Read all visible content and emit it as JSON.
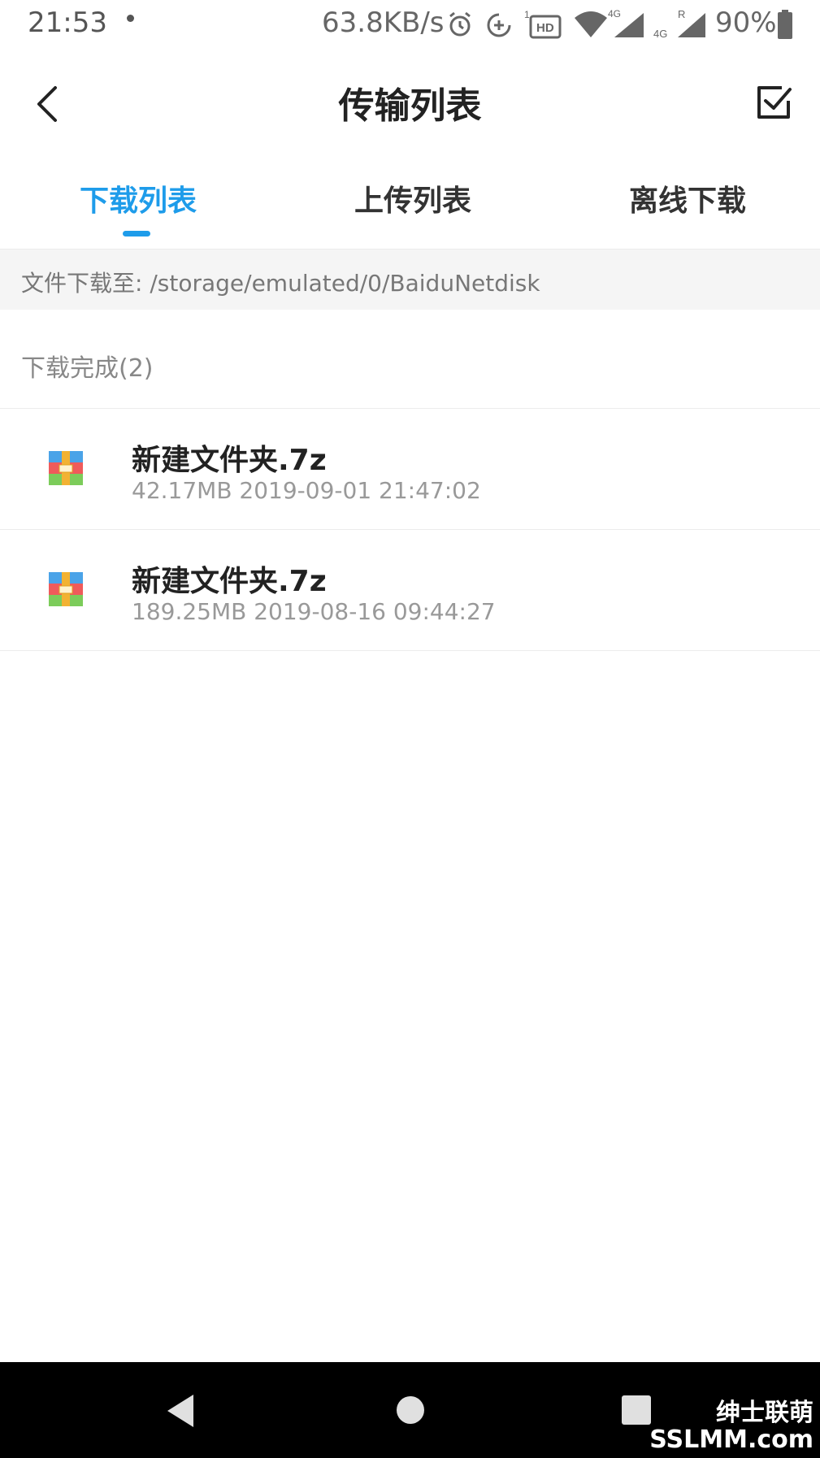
{
  "status_bar": {
    "time": "21:53",
    "net_speed": "63.8KB/s",
    "battery": "90%",
    "icons": [
      "dot-icon",
      "alarm-icon",
      "data-saver-icon",
      "hd-icon",
      "wifi-icon",
      "signal-4g-icon",
      "signal-r-icon",
      "battery-icon"
    ],
    "hd_label": "HD",
    "sim1_label": "4G",
    "sim2_label": "4G",
    "roaming_label": "R"
  },
  "header": {
    "title": "传输列表",
    "back_icon": "chevron-left-icon",
    "select_icon": "checkbox-icon"
  },
  "tabs": [
    {
      "label": "下载列表",
      "active": true
    },
    {
      "label": "上传列表",
      "active": false
    },
    {
      "label": "离线下载",
      "active": false
    }
  ],
  "path_bar": {
    "text": "文件下载至: /storage/emulated/0/BaiduNetdisk"
  },
  "section": {
    "title": "下载完成(2)"
  },
  "files": [
    {
      "name": "新建文件夹.7z",
      "meta": "42.17MB 2019-09-01 21:47:02",
      "icon": "archive-icon"
    },
    {
      "name": "新建文件夹.7z",
      "meta": "189.25MB 2019-08-16 09:44:27",
      "icon": "archive-icon"
    }
  ],
  "nav_bar": {
    "buttons": [
      "back-triangle-icon",
      "home-circle-icon",
      "recents-square-icon"
    ]
  },
  "watermark": {
    "line1": "绅士联萌",
    "line2": "SSLMM.com"
  },
  "colors": {
    "accent": "#1e9cea",
    "text": "#222222",
    "muted": "#999999"
  }
}
